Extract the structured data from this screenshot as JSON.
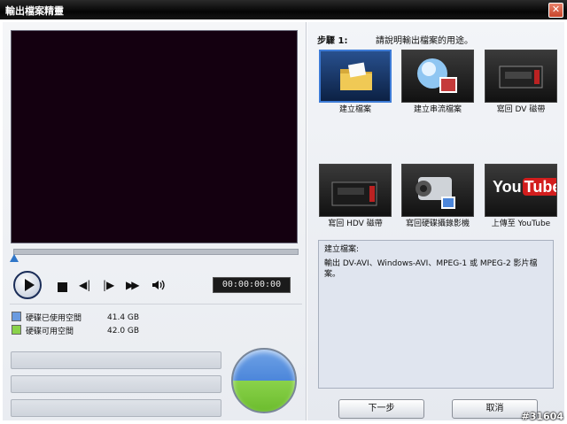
{
  "window": {
    "title": "輸出檔案精靈"
  },
  "player": {
    "timecode": "00:00:00:00"
  },
  "disk": {
    "used_label": "硬碟已使用空間",
    "used_value": "41.4 GB",
    "free_label": "硬碟可用空間",
    "free_value": "42.0 GB",
    "used_color": "#6a9be0",
    "free_color": "#8ad24a"
  },
  "step": {
    "label": "步驟 1:",
    "description": "請說明輸出檔案的用途。"
  },
  "tiles": [
    {
      "label": "建立檔案",
      "icon": "folder-icon",
      "selected": true
    },
    {
      "label": "建立串流檔案",
      "icon": "globe-stream-icon",
      "selected": false
    },
    {
      "label": "寫回 DV 磁帶",
      "icon": "dv-camcorder-icon",
      "selected": false
    },
    {
      "label": "寫回 HDV 磁帶",
      "icon": "hdv-camcorder-icon",
      "selected": false
    },
    {
      "label": "寫回硬碟攝錄影機",
      "icon": "hdd-camcorder-icon",
      "selected": false
    },
    {
      "label": "上傳至 YouTube",
      "icon": "youtube-logo-icon",
      "selected": false
    }
  ],
  "youtube_logo": {
    "you": "You",
    "tube": "Tube"
  },
  "description": {
    "heading": "建立檔案:",
    "body": "輸出 DV-AVI、Windows-AVI、MPEG-1 或 MPEG-2 影片檔案。"
  },
  "buttons": {
    "next": "下一步",
    "cancel": "取消"
  },
  "watermark": "#31604",
  "colors": {
    "accent": "#3d7bd6",
    "preview_bg": "#140010"
  }
}
